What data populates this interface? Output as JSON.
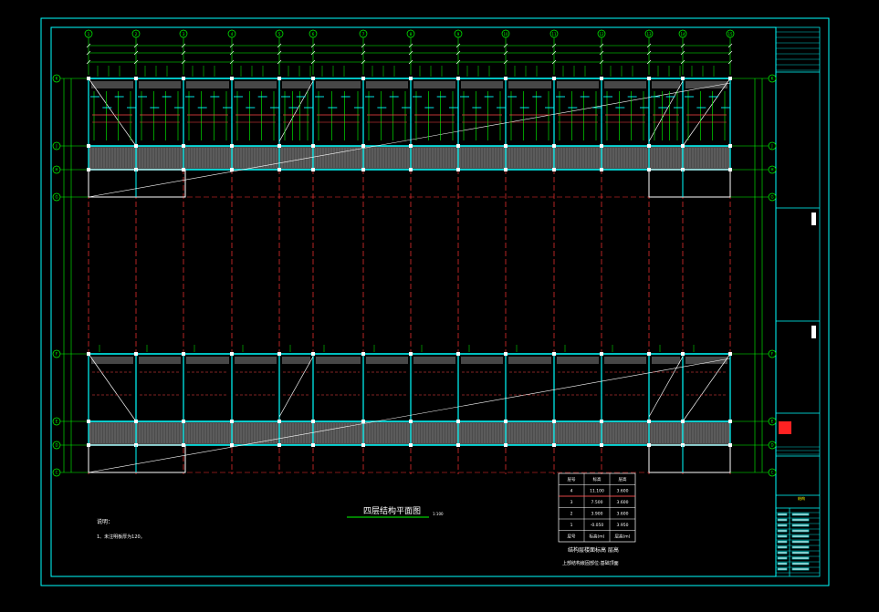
{
  "drawing": {
    "title": "四层结构平面图",
    "scale": "1:100",
    "notes_heading": "说明：",
    "notes": [
      "1、未注明板厚为120。"
    ]
  },
  "axes": {
    "columns": [
      "1",
      "2",
      "3",
      "4",
      "5",
      "6",
      "7",
      "8",
      "9",
      "10",
      "11",
      "12",
      "13",
      "14",
      "15"
    ],
    "rows": [
      "K",
      "J",
      "H",
      "G",
      "F",
      "E",
      "D",
      "C",
      "B",
      "A"
    ]
  },
  "elevation_table": {
    "header": [
      "层号",
      "标高",
      "层高"
    ],
    "rows": [
      [
        "4",
        "11.100",
        "3.600"
      ],
      [
        "3",
        "7.500",
        "3.600"
      ],
      [
        "2",
        "3.900",
        "3.600"
      ],
      [
        "1",
        "-0.050",
        "3.950"
      ]
    ],
    "footer": [
      "层号",
      "标高(m)",
      "层高(m)"
    ],
    "caption": "结构层楼面标高  层高",
    "subcaption": "上部结构嵌固部位:基础顶面"
  },
  "title_block": {
    "stamp": "结构"
  },
  "colors": {
    "background": "#000000",
    "border": "#00ffff",
    "axis": "#00ff00",
    "beam": "#00ffff",
    "centerline": "#ff3333",
    "wall": "#ffffff",
    "hatch": "#888888",
    "accent": "#ffff00"
  }
}
